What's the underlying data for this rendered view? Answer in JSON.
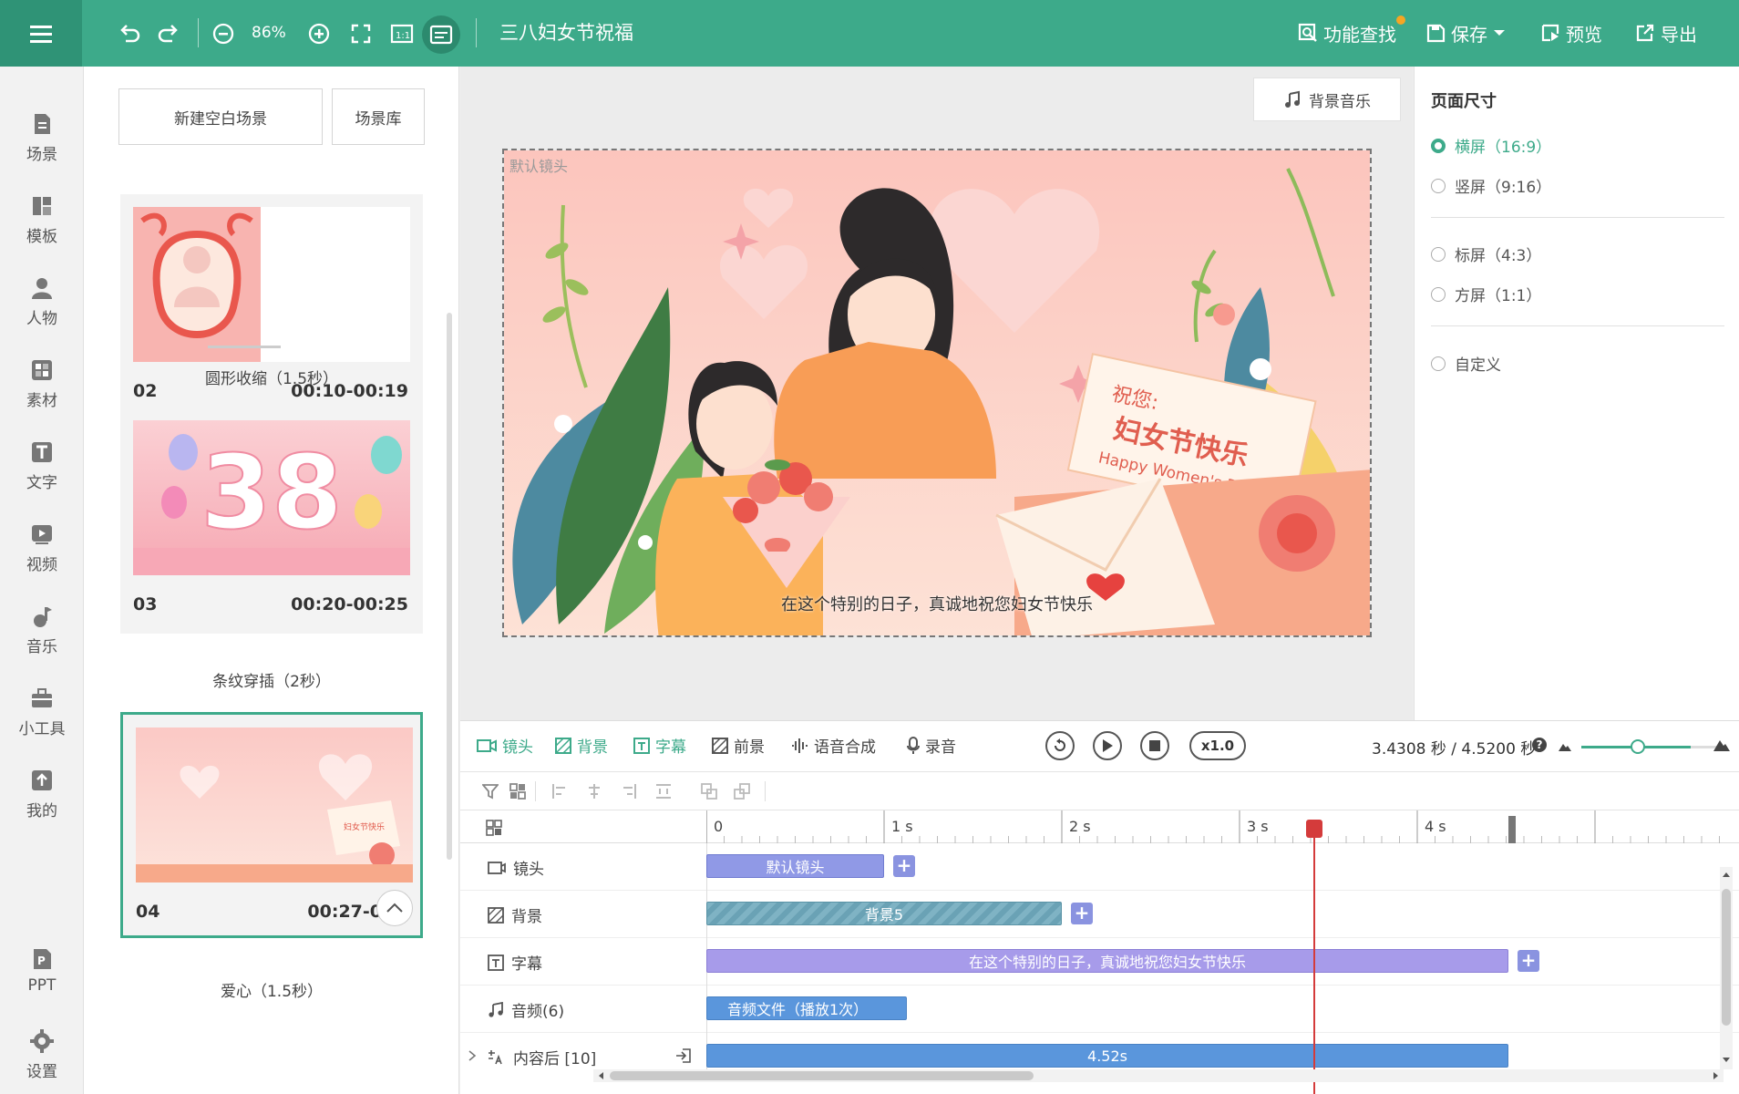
{
  "topbar": {
    "zoom": "86%",
    "title": "三八妇女节祝福",
    "find_label": "功能查找",
    "save_label": "保存",
    "preview_label": "预览",
    "export_label": "导出"
  },
  "leftnav": [
    "场景",
    "模板",
    "人物",
    "素材",
    "文字",
    "视频",
    "音乐",
    "小工具",
    "我的",
    "PPT",
    "设置"
  ],
  "scene_panel": {
    "new_btn": "新建空白场景",
    "lib_btn": "场景库",
    "scenes": [
      {
        "num": "02",
        "time": "00:10-00:19",
        "caption": "圆形收缩（1.5秒）"
      },
      {
        "num": "03",
        "time": "00:20-00:25",
        "caption": "条纹穿插（2秒）"
      },
      {
        "num": "04",
        "time": "00:27-0",
        "caption": "爱心（1.5秒）"
      }
    ],
    "thumb_38": "38",
    "thumb_card_title": "妇女节快乐"
  },
  "canvas": {
    "bgm_label": "背景音乐",
    "stage_label": "默认镜头",
    "subtitle": "在这个特别的日子，真诚地祝您妇女节快乐",
    "card_wish": "祝您:",
    "card_title": "妇女节快乐",
    "card_en": "Happy Women's Day"
  },
  "props": {
    "title": "页面尺寸",
    "options": [
      {
        "label": "横屏（16:9）",
        "selected": true
      },
      {
        "label": "竖屏（9:16）",
        "selected": false
      },
      {
        "label": "标屏（4:3）",
        "selected": false
      },
      {
        "label": "方屏（1:1）",
        "selected": false
      },
      {
        "label": "自定义",
        "selected": false
      }
    ]
  },
  "timeline": {
    "tabs": [
      "镜头",
      "背景",
      "字幕",
      "前景",
      "语音合成",
      "录音"
    ],
    "speed": "x1.0",
    "time_readout": "3.4308 秒 / 4.5200 秒",
    "ruler": [
      "0",
      "1 s",
      "2 s",
      "3 s",
      "4 s"
    ],
    "tracks": [
      {
        "name": "镜头",
        "clip": "默认镜头"
      },
      {
        "name": "背景",
        "clip": "背景5"
      },
      {
        "name": "字幕",
        "clip": "在这个特别的日子，真诚地祝您妇女节快乐"
      },
      {
        "name": "音频(6)",
        "clip": "音频文件（播放1次）"
      },
      {
        "name": "内容后 [10]",
        "clip": "4.52s"
      }
    ],
    "plus": "+"
  },
  "colors": {
    "accent": "#3daa8a",
    "clip": "#9099e6",
    "audio_clip": "#5a96dc",
    "playhead": "#d43b3b"
  }
}
